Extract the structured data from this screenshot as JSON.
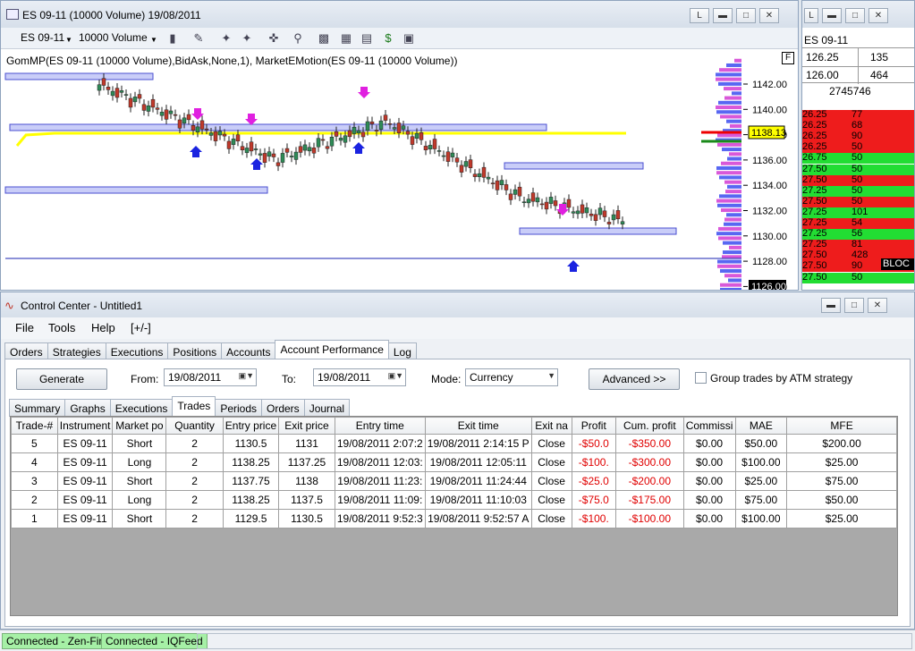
{
  "chart_window": {
    "title": "ES 09-11 (10000 Volume)  19/08/2011",
    "toolbar": {
      "instrument": "ES 09-11",
      "interval": "10000 Volume"
    },
    "indicator_label": "GomMP(ES 09-11 (10000 Volume),BidAsk,None,1), MarketEMotion(ES 09-11 (10000 Volume))",
    "price_axis": [
      "1142.00",
      "1140.00",
      "1138.00",
      "1136.00",
      "1134.00",
      "1132.00",
      "1130.00",
      "1128.00",
      "1126.00"
    ],
    "last_price_tag": "1138.13",
    "current_price_tag": "1126.00",
    "panel_flag": "F",
    "colors": {
      "up": "#2e8b57",
      "down": "#c0392b",
      "band": "#c9cdf8",
      "ema": "#ffff00"
    }
  },
  "dom_window": {
    "instrument": "ES 09-11",
    "bid_price": "126.25",
    "bid_size": "135",
    "ask_price": "126.00",
    "ask_size": "464",
    "volume": "2745746",
    "block_label": "BLOC",
    "ladder": [
      {
        "price": "26.25",
        "size": "77",
        "color": "red"
      },
      {
        "price": "26.25",
        "size": "68",
        "color": "red"
      },
      {
        "price": "26.25",
        "size": "90",
        "color": "red"
      },
      {
        "price": "26.25",
        "size": "50",
        "color": "red"
      },
      {
        "price": "26.75",
        "size": "50",
        "color": "green"
      },
      {
        "price": "27.50",
        "size": "50",
        "color": "green"
      },
      {
        "price": "27.50",
        "size": "50",
        "color": "red"
      },
      {
        "price": "27.25",
        "size": "50",
        "color": "green"
      },
      {
        "price": "27.50",
        "size": "50",
        "color": "red"
      },
      {
        "price": "27.25",
        "size": "101",
        "color": "green"
      },
      {
        "price": "27.25",
        "size": "54",
        "color": "red"
      },
      {
        "price": "27.25",
        "size": "56",
        "color": "green"
      },
      {
        "price": "27.25",
        "size": "81",
        "color": "red"
      },
      {
        "price": "27.50",
        "size": "428",
        "color": "red"
      },
      {
        "price": "27.50",
        "size": "90",
        "color": "red"
      },
      {
        "price": "27.50",
        "size": "50",
        "color": "green"
      }
    ]
  },
  "control_center": {
    "title": "Control Center - Untitled1",
    "menu": [
      "File",
      "Tools",
      "Help",
      "[+/-]"
    ],
    "tabs": [
      "Orders",
      "Strategies",
      "Executions",
      "Positions",
      "Accounts",
      "Account Performance",
      "Log"
    ],
    "active_tab": "Account Performance",
    "generate_label": "Generate",
    "from_label": "From:",
    "from_date": "19/08/2011",
    "to_label": "To:",
    "to_date": "19/08/2011",
    "mode_label": "Mode:",
    "mode_value": "Currency",
    "advanced_label": "Advanced >>",
    "group_label": "Group trades by ATM strategy",
    "sub_tabs": [
      "Summary",
      "Graphs",
      "Executions",
      "Trades",
      "Periods",
      "Orders",
      "Journal"
    ],
    "active_sub_tab": "Trades",
    "trades_columns": [
      "Trade-#",
      "Instrument",
      "Market po",
      "Quantity",
      "Entry price",
      "Exit price",
      "Entry time",
      "Exit time",
      "Exit na",
      "Profit",
      "Cum. profit",
      "Commissi",
      "MAE",
      "MFE"
    ],
    "trades": [
      [
        "5",
        "ES 09-11",
        "Short",
        "2",
        "1130.5",
        "1131",
        "19/08/2011 2:07:2",
        "19/08/2011 2:14:15 P",
        "Close",
        "-$50.0",
        "-$350.00",
        "$0.00",
        "$50.00",
        "$200.00"
      ],
      [
        "4",
        "ES 09-11",
        "Long",
        "2",
        "1138.25",
        "1137.25",
        "19/08/2011 12:03:",
        "19/08/2011 12:05:11",
        "Close",
        "-$100.",
        "-$300.00",
        "$0.00",
        "$100.00",
        "$25.00"
      ],
      [
        "3",
        "ES 09-11",
        "Short",
        "2",
        "1137.75",
        "1138",
        "19/08/2011 11:23:",
        "19/08/2011 11:24:44",
        "Close",
        "-$25.0",
        "-$200.00",
        "$0.00",
        "$25.00",
        "$75.00"
      ],
      [
        "2",
        "ES 09-11",
        "Long",
        "2",
        "1138.25",
        "1137.5",
        "19/08/2011 11:09:",
        "19/08/2011 11:10:03",
        "Close",
        "-$75.0",
        "-$175.00",
        "$0.00",
        "$75.00",
        "$50.00"
      ],
      [
        "1",
        "ES 09-11",
        "Short",
        "2",
        "1129.5",
        "1130.5",
        "19/08/2011 9:52:3",
        "19/08/2011 9:52:57 A",
        "Close",
        "-$100.",
        "-$100.00",
        "$0.00",
        "$100.00",
        "$25.00"
      ]
    ]
  },
  "status": [
    "Connected - Zen-Fire",
    "Connected - IQFeed"
  ]
}
